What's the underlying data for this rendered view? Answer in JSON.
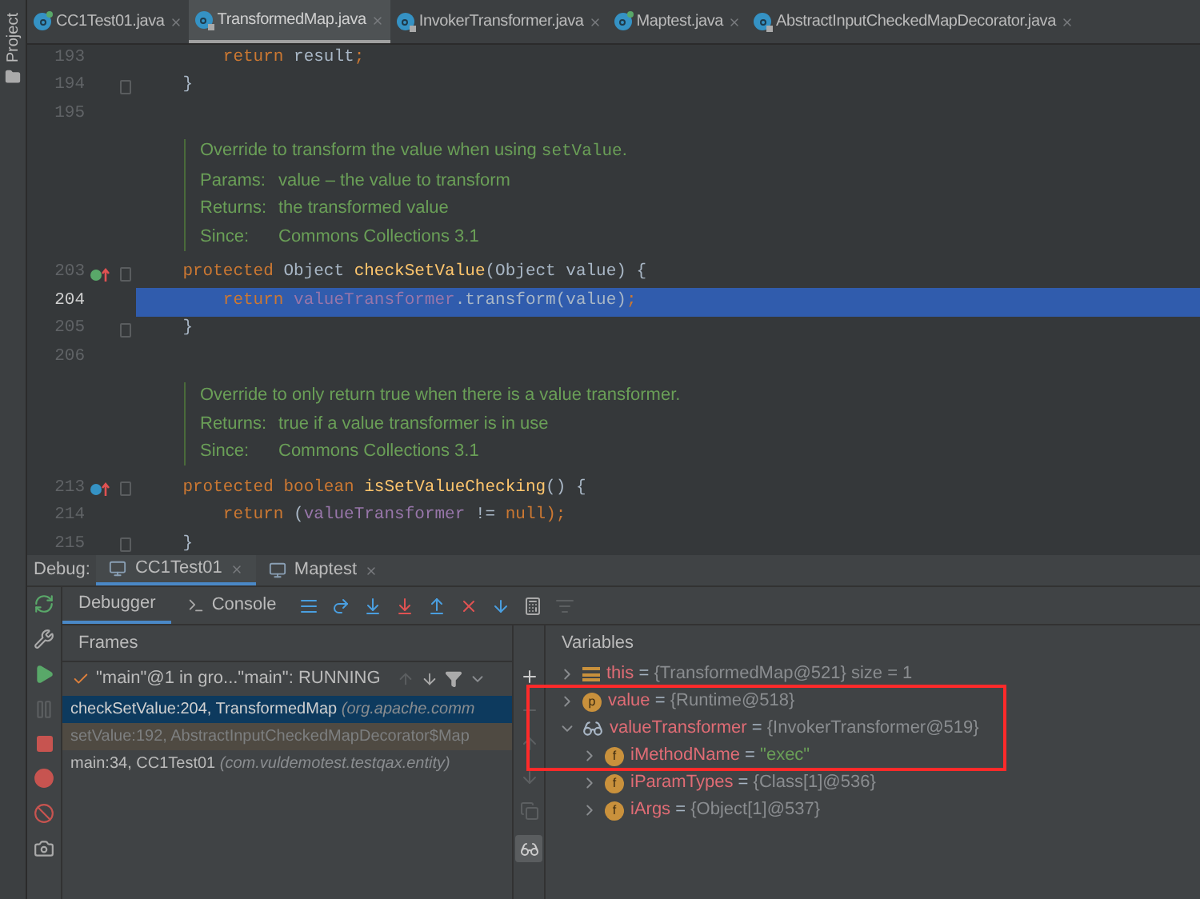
{
  "sidebar_tab": "Project",
  "tabs": [
    {
      "label": "CC1Test01.java",
      "selected": false,
      "kind": "runnable"
    },
    {
      "label": "TransformedMap.java",
      "selected": true,
      "kind": "locked"
    },
    {
      "label": "InvokerTransformer.java",
      "selected": false,
      "kind": "locked"
    },
    {
      "label": "Maptest.java",
      "selected": false,
      "kind": "runnable"
    },
    {
      "label": "AbstractInputCheckedMapDecorator.java",
      "selected": false,
      "kind": "locked"
    }
  ],
  "editor": {
    "blocks": [
      {
        "kind": "code",
        "number": "193",
        "current": false,
        "fold": false,
        "tokens": [
          {
            "text": "        return",
            "kind": "keyword"
          },
          {
            "text": " result",
            "kind": "plain"
          },
          {
            "text": ";",
            "kind": "keyword"
          }
        ]
      },
      {
        "kind": "code",
        "number": "194",
        "current": false,
        "fold": true,
        "tokens": [
          {
            "text": "    }",
            "kind": "plain"
          }
        ]
      },
      {
        "kind": "code",
        "number": "195",
        "current": false,
        "fold": false
      },
      {
        "kind": "doc",
        "lines": [
          {
            "text": "Override to transform the value when using ",
            "code": "setValue",
            "end": "."
          },
          {
            "label": "Params:",
            "text": "value – the value to transform"
          },
          {
            "label": "Returns:",
            "text": "the transformed value"
          },
          {
            "label": "Since:",
            "text": "Commons Collections 3.1"
          }
        ]
      },
      {
        "kind": "code",
        "number": "203",
        "current": false,
        "fold": true,
        "marker": {
          "kind": "implements"
        },
        "tokens": [
          {
            "text": "    protected ",
            "kind": "keyword"
          },
          {
            "text": "Object ",
            "kind": "plain"
          },
          {
            "text": "checkSetValue",
            "kind": "method"
          },
          {
            "text": "(Object value) {",
            "kind": "plain"
          }
        ]
      },
      {
        "kind": "code",
        "number": "204",
        "current": true,
        "fold": false,
        "tokens": [
          {
            "text": "        return ",
            "kind": "keyword"
          },
          {
            "text": "valueTransformer",
            "kind": "field"
          },
          {
            "text": ".transform(value)",
            "kind": "plain"
          },
          {
            "text": ";",
            "kind": "keyword"
          }
        ]
      },
      {
        "kind": "code",
        "number": "205",
        "current": false,
        "fold": true,
        "tokens": [
          {
            "text": "    }",
            "kind": "plain"
          }
        ]
      },
      {
        "kind": "code",
        "number": "206",
        "current": false,
        "fold": false
      },
      {
        "kind": "doc",
        "lines": [
          {
            "text": "Override to only return true when there is a value transformer."
          },
          {
            "label": "Returns:",
            "text": "true if a value transformer is in use"
          },
          {
            "label": "Since:",
            "text": "Commons Collections 3.1"
          }
        ]
      },
      {
        "kind": "code",
        "number": "213",
        "current": false,
        "fold": true,
        "marker": {
          "kind": "overrides"
        },
        "tokens": [
          {
            "text": "    protected boolean ",
            "kind": "keyword"
          },
          {
            "text": "isSetValueChecking",
            "kind": "method"
          },
          {
            "text": "() {",
            "kind": "plain"
          }
        ]
      },
      {
        "kind": "code",
        "number": "214",
        "current": false,
        "fold": false,
        "tokens": [
          {
            "text": "        return ",
            "kind": "keyword"
          },
          {
            "text": "(",
            "kind": "plain"
          },
          {
            "text": "valueTransformer",
            "kind": "field"
          },
          {
            "text": " != ",
            "kind": "plain"
          },
          {
            "text": "null",
            "kind": "keyword"
          },
          {
            "text": ");",
            "kind": "keyword"
          }
        ]
      },
      {
        "kind": "code",
        "number": "215",
        "current": false,
        "fold": true,
        "tokens": [
          {
            "text": "    }",
            "kind": "plain"
          }
        ]
      }
    ]
  },
  "debug": {
    "label": "Debug:",
    "tabs": [
      {
        "label": "CC1Test01",
        "selected": true
      },
      {
        "label": "Maptest",
        "selected": false
      }
    ],
    "subtabs": [
      {
        "label": "Debugger",
        "selected": true,
        "kind": "debugger"
      },
      {
        "label": "Console",
        "selected": false,
        "kind": "console"
      }
    ],
    "frames": {
      "title": "Frames",
      "thread": "\"main\"@1 in gro...\"main\": RUNNING",
      "items": [
        {
          "method": "checkSetValue:204, TransformedMap",
          "package": "(org.apache.comm",
          "selected": true,
          "library": false
        },
        {
          "method": "setValue:192, AbstractInputCheckedMapDecorator$Map",
          "selected": false,
          "library": true
        },
        {
          "method": "main:34, CC1Test01",
          "package": "(com.vuldemotest.testqax.entity)",
          "selected": false,
          "library": false
        }
      ]
    },
    "variables": {
      "title": "Variables",
      "items": [
        {
          "name": "this",
          "operator": "=",
          "value": "{TransformedMap@521} size = 1",
          "kind": "list",
          "expanded": false
        },
        {
          "name": "value",
          "operator": "=",
          "value": "{Runtime@518}",
          "kind": "parameter",
          "badge": "p",
          "expanded": false
        },
        {
          "name": "valueTransformer",
          "operator": "=",
          "value": "{InvokerTransformer@519}",
          "kind": "watch",
          "expanded": true,
          "children": [
            {
              "name": "iMethodName",
              "operator": "=",
              "value": "\"exec\"",
              "kind": "field",
              "badge": "f",
              "expanded": false,
              "string": true
            },
            {
              "name": "iParamTypes",
              "operator": "=",
              "value": "{Class[1]@536}",
              "kind": "field",
              "badge": "f",
              "expanded": false,
              "string": false
            },
            {
              "name": "iArgs",
              "operator": "=",
              "value": "{Object[1]@537}",
              "kind": "field",
              "badge": "f",
              "expanded": false,
              "string": false
            }
          ]
        }
      ]
    }
  }
}
